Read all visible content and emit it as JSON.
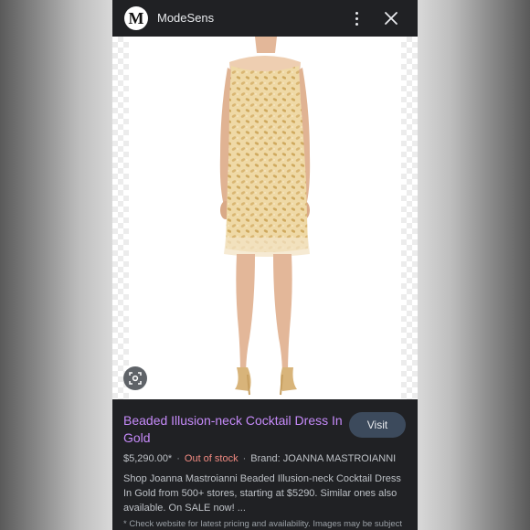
{
  "header": {
    "logo_letter": "M",
    "site_name": "ModeSens"
  },
  "product": {
    "title": "Beaded Illusion-neck Cocktail Dress In Gold",
    "visit_label": "Visit",
    "price": "$5,290.00*",
    "stock_status": "Out of stock",
    "brand": "Brand: JOANNA MASTROIANNI",
    "separator": "·",
    "description": "Shop Joanna Mastroianni Beaded Illusion-neck Cocktail Dress In Gold from 500+ stores, starting at $5290. Similar ones also available. On SALE now! ...",
    "footnote": "* Check website for latest pricing and availability. Images may be subject"
  },
  "icons": {
    "menu": "more-vert-icon",
    "close": "close-icon",
    "lens": "lens-search-icon"
  },
  "colors": {
    "title_link": "#c58af9",
    "out_of_stock": "#f28b82",
    "dress_gold": "#e8c98a",
    "background": "#202124"
  }
}
